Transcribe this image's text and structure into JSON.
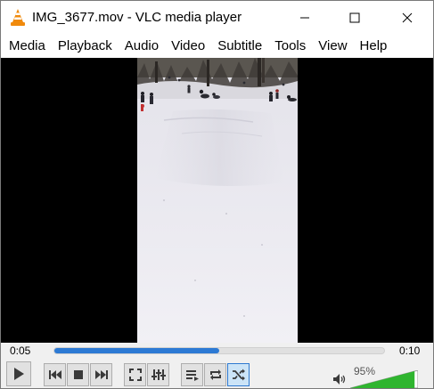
{
  "window": {
    "title": "IMG_3677.mov - VLC media player",
    "icon": "vlc-cone-icon"
  },
  "menu": {
    "items": [
      "Media",
      "Playback",
      "Audio",
      "Video",
      "Subtitle",
      "Tools",
      "View",
      "Help"
    ]
  },
  "player": {
    "elapsed": "0:05",
    "total": "0:10",
    "progress": 0.5,
    "volume_label": "95%",
    "volume": 0.95,
    "random_active": true
  },
  "colors": {
    "seek_fill": "#2d7ad4",
    "volume_green": "#2fb52f",
    "vlc_orange": "#f08a0c"
  }
}
